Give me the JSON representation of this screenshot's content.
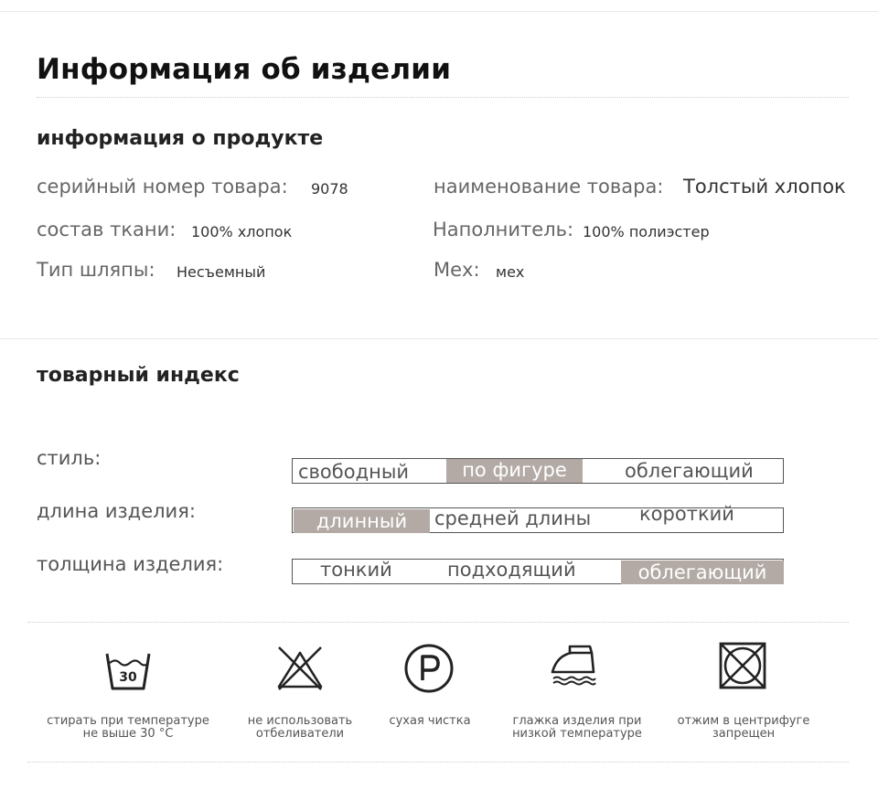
{
  "page_title": "Информация об изделии",
  "product_info": {
    "heading": "информация о продукте",
    "serial_label": "серийный номер товара:",
    "serial_value": "9078",
    "name_label": "наименование товара:",
    "name_value": "Толстый хлопок",
    "fabric_label": "состав ткани:",
    "fabric_value": "100% хлопок",
    "filler_label": "Наполнитель:",
    "filler_value": "100% полиэстер",
    "hat_label": "Тип шляпы:",
    "hat_value": "Несъемный",
    "fur_label": "Мех:",
    "fur_value": "мех"
  },
  "product_index": {
    "heading": "товарный индекс",
    "style": {
      "label": "стиль:",
      "options": [
        "свободный",
        "по фигуре",
        "облегающий"
      ],
      "selected": "по фигуре"
    },
    "length": {
      "label": "длина изделия:",
      "options": [
        "длинный",
        "средней длины",
        "короткий"
      ],
      "selected": "длинный"
    },
    "thickness": {
      "label": "толщина изделия:",
      "options": [
        "тонкий",
        "подходящий",
        "облегающий"
      ],
      "selected": "облегающий"
    }
  },
  "care": {
    "wash_temp_number": "30",
    "items": [
      {
        "icon": "wash-30-icon",
        "line1": "стирать при температуре",
        "line2": "не выше 30 °С"
      },
      {
        "icon": "no-bleach-icon",
        "line1": "не использовать",
        "line2": "отбеливатели"
      },
      {
        "icon": "dry-clean-icon",
        "line1": "сухая чистка",
        "line2": ""
      },
      {
        "icon": "iron-low-icon",
        "line1": "глажка изделия при",
        "line2": "низкой температуре"
      },
      {
        "icon": "no-tumble-dry-icon",
        "line1": "отжим в центрифуге",
        "line2": "запрещен"
      }
    ]
  }
}
